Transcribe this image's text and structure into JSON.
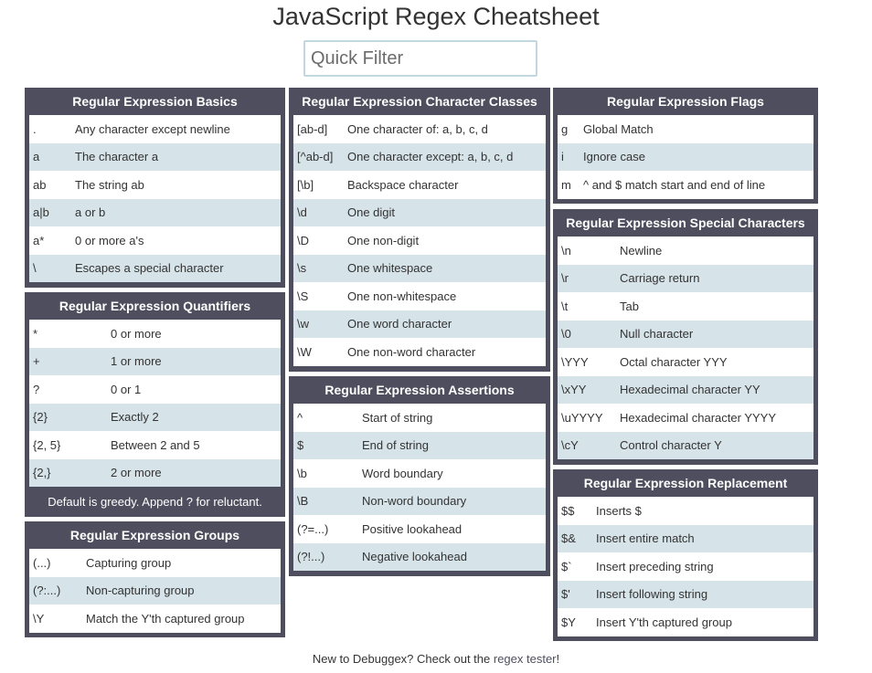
{
  "page": {
    "title": "JavaScript Regex Cheatsheet",
    "filter_placeholder": "Quick Filter"
  },
  "panels": {
    "basics": {
      "title": "Regular Expression Basics",
      "rows": [
        {
          "k": ".",
          "d": "Any character except newline"
        },
        {
          "k": "a",
          "d": "The character a"
        },
        {
          "k": "ab",
          "d": "The string ab"
        },
        {
          "k": "a|b",
          "d": "a or b"
        },
        {
          "k": "a*",
          "d": "0 or more a's"
        },
        {
          "k": "\\",
          "d": "Escapes a special character"
        }
      ]
    },
    "quantifiers": {
      "title": "Regular Expression Quantifiers",
      "rows": [
        {
          "k": "*",
          "d": "0 or more"
        },
        {
          "k": "+",
          "d": "1 or more"
        },
        {
          "k": "?",
          "d": "0 or 1"
        },
        {
          "k": "{2}",
          "d": "Exactly 2"
        },
        {
          "k": "{2, 5}",
          "d": "Between 2 and 5"
        },
        {
          "k": "{2,}",
          "d": "2 or more"
        }
      ],
      "note": "Default is greedy. Append ? for reluctant."
    },
    "groups": {
      "title": "Regular Expression Groups",
      "rows": [
        {
          "k": "(...)",
          "d": "Capturing group"
        },
        {
          "k": "(?:...)",
          "d": "Non-capturing group"
        },
        {
          "k": "\\Y",
          "d": "Match the Y'th captured group"
        }
      ]
    },
    "classes": {
      "title": "Regular Expression Character Classes",
      "rows": [
        {
          "k": "[ab-d]",
          "d": "One character of: a, b, c, d"
        },
        {
          "k": "[^ab-d]",
          "d": "One character except: a, b, c, d"
        },
        {
          "k": "[\\b]",
          "d": "Backspace character"
        },
        {
          "k": "\\d",
          "d": "One digit"
        },
        {
          "k": "\\D",
          "d": "One non-digit"
        },
        {
          "k": "\\s",
          "d": "One whitespace"
        },
        {
          "k": "\\S",
          "d": "One non-whitespace"
        },
        {
          "k": "\\w",
          "d": "One word character"
        },
        {
          "k": "\\W",
          "d": "One non-word character"
        }
      ]
    },
    "assertions": {
      "title": "Regular Expression Assertions",
      "rows": [
        {
          "k": "^",
          "d": "Start of string"
        },
        {
          "k": "$",
          "d": "End of string"
        },
        {
          "k": "\\b",
          "d": "Word boundary"
        },
        {
          "k": "\\B",
          "d": "Non-word boundary"
        },
        {
          "k": "(?=...)",
          "d": "Positive lookahead"
        },
        {
          "k": "(?!...)",
          "d": "Negative lookahead"
        }
      ]
    },
    "flags": {
      "title": "Regular Expression Flags",
      "rows": [
        {
          "k": "g",
          "d": "Global Match"
        },
        {
          "k": "i",
          "d": "Ignore case"
        },
        {
          "k": "m",
          "d": "^ and $ match start and end of line"
        }
      ]
    },
    "special": {
      "title": "Regular Expression Special Characters",
      "rows": [
        {
          "k": "\\n",
          "d": "Newline"
        },
        {
          "k": "\\r",
          "d": "Carriage return"
        },
        {
          "k": "\\t",
          "d": "Tab"
        },
        {
          "k": "\\0",
          "d": "Null character"
        },
        {
          "k": "\\YYY",
          "d": "Octal character YYY"
        },
        {
          "k": "\\xYY",
          "d": "Hexadecimal character YY"
        },
        {
          "k": "\\uYYYY",
          "d": "Hexadecimal character YYYY"
        },
        {
          "k": "\\cY",
          "d": "Control character Y"
        }
      ]
    },
    "replacement": {
      "title": "Regular Expression Replacement",
      "rows": [
        {
          "k": "$$",
          "d": "Inserts $"
        },
        {
          "k": "$&",
          "d": "Insert entire match"
        },
        {
          "k": "$`",
          "d": "Insert preceding string"
        },
        {
          "k": "$'",
          "d": "Insert following string"
        },
        {
          "k": "$Y",
          "d": "Insert Y'th captured group"
        }
      ]
    }
  },
  "footer": {
    "text": "New to Debuggex? Check out the ",
    "link": "regex tester",
    "suffix": "!"
  }
}
